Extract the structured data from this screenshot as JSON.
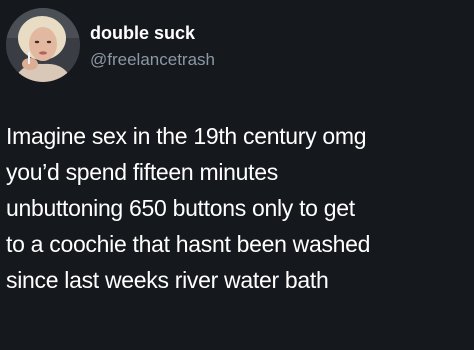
{
  "tweet": {
    "author_name": "double suck",
    "author_handle": "@freelancetrash",
    "avatar_icon": "avatar-photo-icon",
    "lines": [
      "Imagine sex in the 19th century omg",
      "you’d spend fifteen minutes",
      "unbuttoning 650 buttons only to get",
      "to a coochie that hasnt been washed",
      "since last weeks river water bath"
    ]
  },
  "colors": {
    "background": "#15181c",
    "text": "#ffffff",
    "handle": "#8b98a5"
  }
}
